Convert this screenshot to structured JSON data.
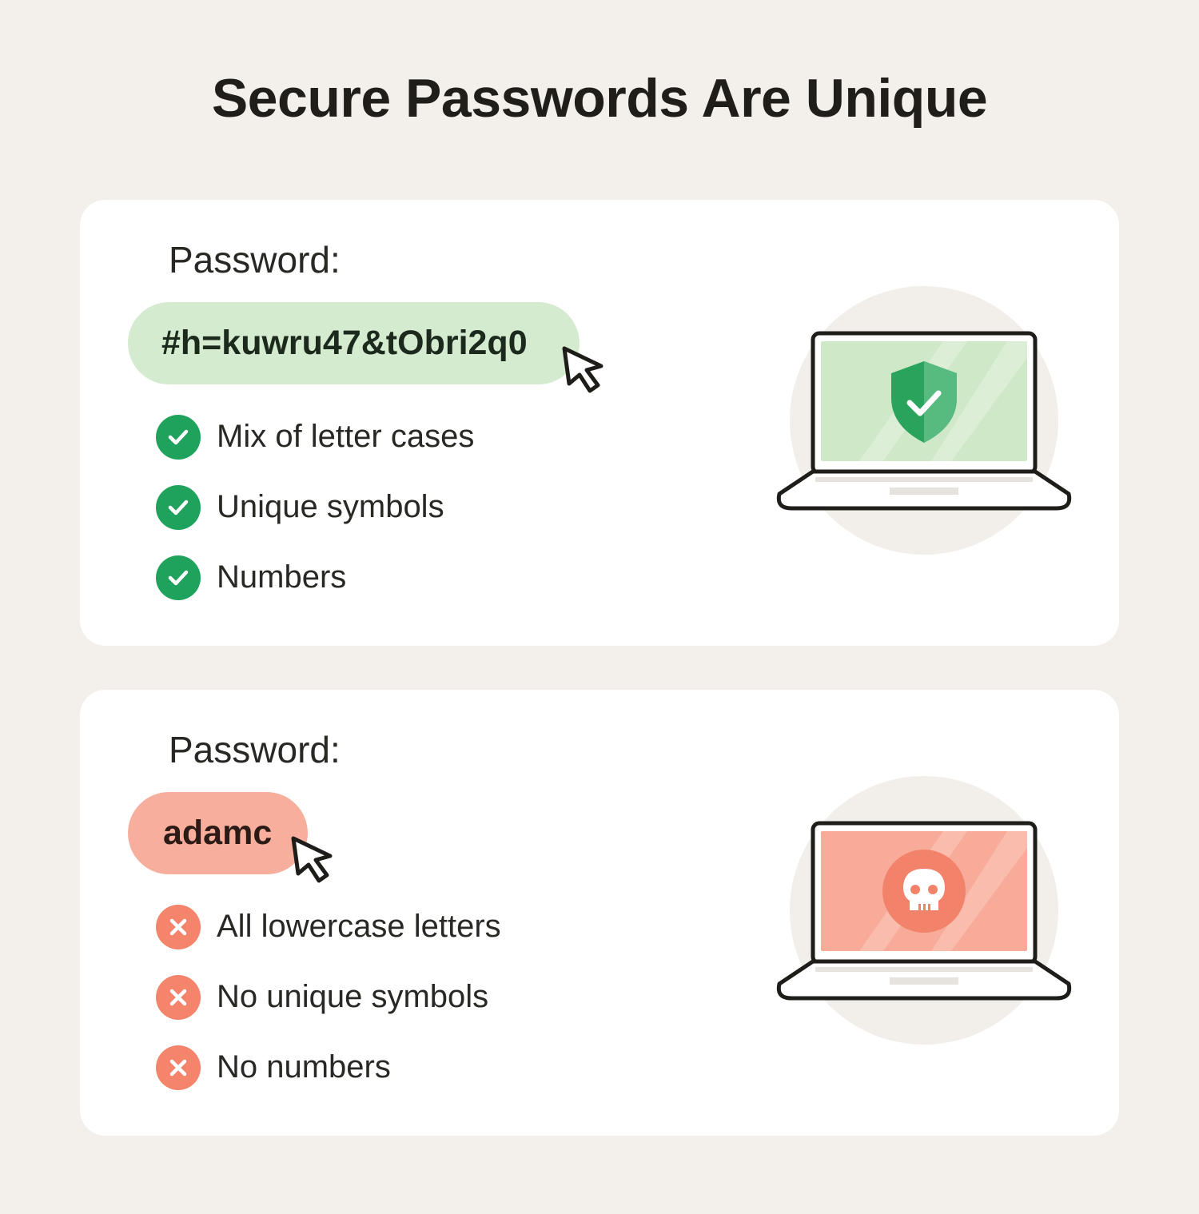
{
  "title": "Secure Passwords Are Unique",
  "colors": {
    "background": "#f3f0eb",
    "card": "#ffffff",
    "strong_pill": "#d5ebcf",
    "strong_accent": "#1fa35c",
    "weak_pill": "#f8ae9c",
    "weak_accent": "#f4846b"
  },
  "strong": {
    "label": "Password:",
    "password": "#h=kuwru47&tObri2q0",
    "criteria": [
      {
        "text": "Mix of letter cases",
        "icon": "check-circle-icon"
      },
      {
        "text": "Unique symbols",
        "icon": "check-circle-icon"
      },
      {
        "text": "Numbers",
        "icon": "check-circle-icon"
      }
    ],
    "illustration": {
      "device": "laptop-icon",
      "screen_icon": "shield-check-icon"
    }
  },
  "weak": {
    "label": "Password:",
    "password": "adamc",
    "criteria": [
      {
        "text": "All lowercase letters",
        "icon": "x-circle-icon"
      },
      {
        "text": "No unique symbols",
        "icon": "x-circle-icon"
      },
      {
        "text": "No numbers",
        "icon": "x-circle-icon"
      }
    ],
    "illustration": {
      "device": "laptop-icon",
      "screen_icon": "skull-icon"
    }
  }
}
